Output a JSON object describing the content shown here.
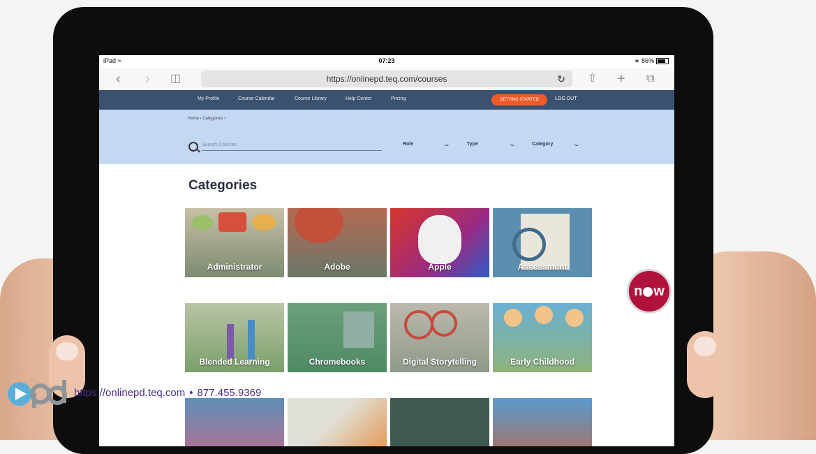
{
  "status_bar": {
    "carrier": "iPad",
    "time": "07:23",
    "battery": "86%"
  },
  "browser": {
    "url": "https://onlinepd.teq.com/courses"
  },
  "nav": {
    "items": [
      "My Profile",
      "Course Calendar",
      "Course Library",
      "Help Center",
      "Pricing"
    ],
    "getting_started": "GETTING STARTED",
    "logout": "LOG OUT"
  },
  "breadcrumb": "Home › Categories ›",
  "search": {
    "placeholder": "Search Courses"
  },
  "filters": [
    "Role",
    "Type",
    "Category"
  ],
  "page": {
    "title": "Categories"
  },
  "categories": [
    "Administrator",
    "Adobe",
    "Apple",
    "Assessment",
    "Blended Learning",
    "Chromebooks",
    "Digital Storytelling",
    "Early Childhood"
  ],
  "badge": {
    "left": "n",
    "right": "w"
  },
  "contact": {
    "url": "https://onlinepd.teq.com",
    "separator": "•",
    "phone": "877.455.9369"
  },
  "colors": {
    "nav": "#3b5170",
    "band": "#c5d8f2",
    "cta": "#f05a28",
    "badge": "#b0123c",
    "contact": "#4a2b8a"
  }
}
